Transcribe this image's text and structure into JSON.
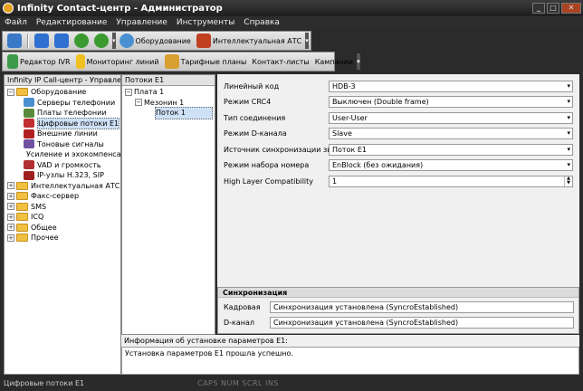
{
  "window": {
    "title": "Infinity Contact-центр  - Администратор"
  },
  "menu": [
    "Файл",
    "Редактирование",
    "Управление",
    "Инструменты",
    "Справка"
  ],
  "toolbar1": {
    "hardware_label": "Оборудование",
    "ipbx_label": "Интеллектуальная АТС"
  },
  "toolbar2": {
    "ivr_label": "Редактор IVR",
    "monitor_label": "Мониторинг линий",
    "tariff_label": "Тарифные планы",
    "contacts_label": "Контакт-листы",
    "campaigns_label": "Кампании"
  },
  "left_panel": {
    "header": "Infinity IP Call-центр - Управление",
    "items": [
      {
        "label": "Оборудование",
        "level": 0,
        "kind": "folder",
        "expander": "−"
      },
      {
        "label": "Серверы телефонии",
        "level": 1,
        "kind": "gear"
      },
      {
        "label": "Платы телефонии",
        "level": 1,
        "kind": "card"
      },
      {
        "label": "Цифровые потоки E1",
        "level": 1,
        "kind": "e1",
        "selected": true
      },
      {
        "label": "Внешние линии",
        "level": 1,
        "kind": "fxo"
      },
      {
        "label": "Тоновые сигналы",
        "level": 1,
        "kind": "tone"
      },
      {
        "label": "Усиление и эхокомпенсация",
        "level": 1,
        "kind": "gain"
      },
      {
        "label": "VAD и громкость",
        "level": 1,
        "kind": "vad"
      },
      {
        "label": "IP-узлы H.323, SIP",
        "level": 1,
        "kind": "ip"
      },
      {
        "label": "Интеллектуальная АТС",
        "level": 0,
        "kind": "folder",
        "expander": "+"
      },
      {
        "label": "Факс-сервер",
        "level": 0,
        "kind": "folder",
        "expander": "+"
      },
      {
        "label": "SMS",
        "level": 0,
        "kind": "folder",
        "expander": "+"
      },
      {
        "label": "ICQ",
        "level": 0,
        "kind": "folder",
        "expander": "+"
      },
      {
        "label": "Общее",
        "level": 0,
        "kind": "folder",
        "expander": "+"
      },
      {
        "label": "Прочее",
        "level": 0,
        "kind": "folder",
        "expander": "+"
      }
    ]
  },
  "mid_panel": {
    "header": "Потоки E1",
    "items": [
      {
        "label": "Плата 1",
        "level": 0,
        "expander": "−"
      },
      {
        "label": "Мезонин 1",
        "level": 1,
        "expander": "−"
      },
      {
        "label": "Поток 1",
        "level": 2,
        "selected": true
      }
    ]
  },
  "form": {
    "rows": [
      {
        "label": "Линейный код",
        "value": "HDB-3",
        "control": "combo"
      },
      {
        "label": "Режим CRC4",
        "value": "Выключен (Double frame)",
        "control": "combo"
      },
      {
        "label": "Тип соединения",
        "value": "User-User",
        "control": "combo"
      },
      {
        "label": "Режим D-канала",
        "value": "Slave",
        "control": "combo"
      },
      {
        "label": "Источник синхронизации звука",
        "value": "Поток E1",
        "control": "combo"
      },
      {
        "label": "Режим набора номера",
        "value": "EnBlock (без ожидания)",
        "control": "combo"
      },
      {
        "label": "High Layer Compatibility",
        "value": "1",
        "control": "spin"
      }
    ]
  },
  "sync": {
    "header": "Синхронизация",
    "frame_label": "Кадровая",
    "frame_value": "Синхронизация установлена (SyncroEstablished)",
    "dchan_label": "D-канал",
    "dchan_value": "Синхронизация установлена (SyncroEstablished)"
  },
  "info": {
    "header": "Информация об установке параметров E1:",
    "text": "Установка параметров E1 прошла успешно."
  },
  "status": {
    "left": "Цифровые потоки E1",
    "keys": "CAPS  NUM  SCRL  INS"
  },
  "colors": {
    "folder": "#f0c040",
    "selection": "#cde0f5",
    "toolbar": "#d8d8d8"
  }
}
